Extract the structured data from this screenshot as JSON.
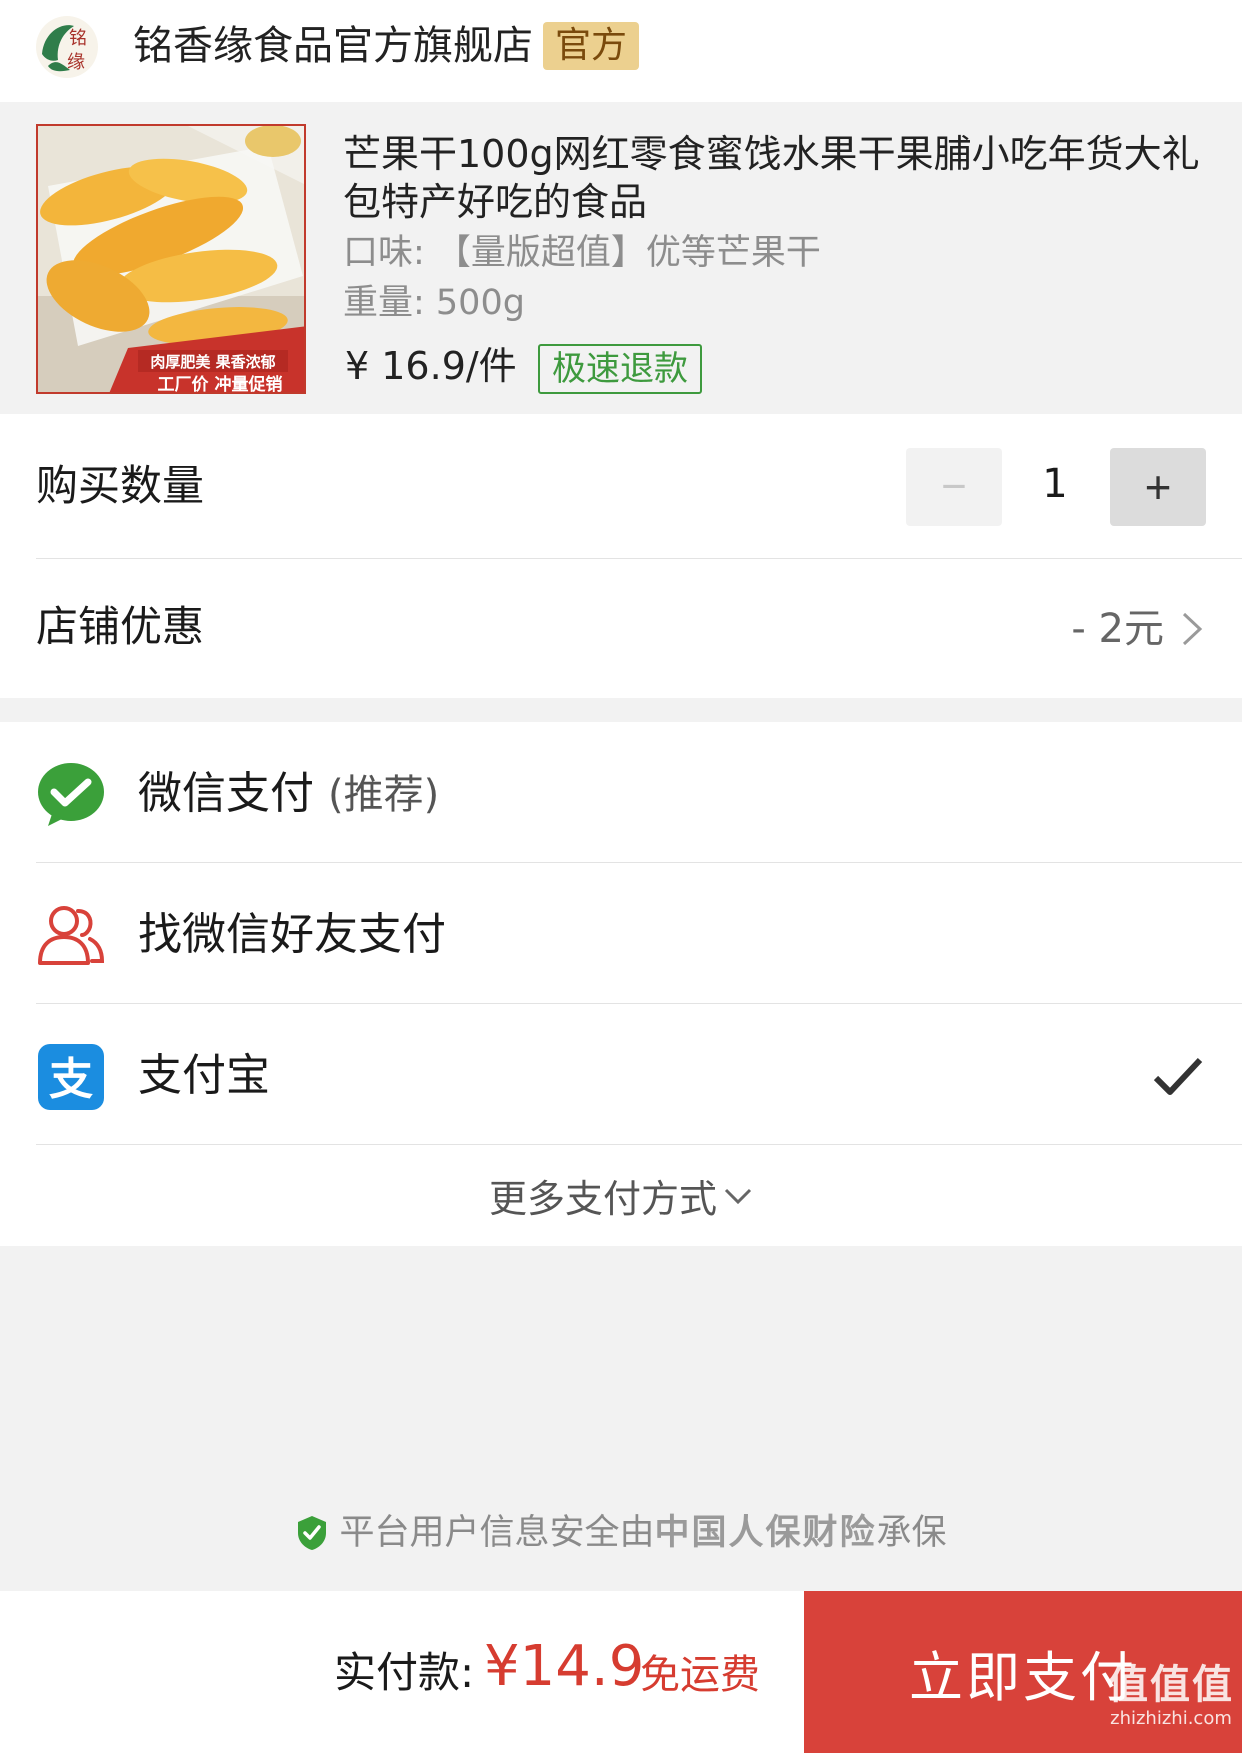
{
  "store": {
    "name": "铭香缘食品官方旗舰店",
    "badge": "官方",
    "logo_text": "铭香缘"
  },
  "product": {
    "title": "芒果干100g网红零食蜜饯水果干果脯小吃年货大礼包特产好吃的食品",
    "flavor": "口味: 【量版超值】优等芒果干",
    "weight": "重量: 500g",
    "price": "¥ 16.9/件",
    "refund_badge": "极速退款",
    "image_caption_1": "肉厚肥美 果香浓郁",
    "image_caption_2": "工厂价 冲量促销"
  },
  "quantity": {
    "label": "购买数量",
    "minus": "−",
    "value": "1",
    "plus": "+"
  },
  "discount": {
    "label": "店铺优惠",
    "value": "- 2元"
  },
  "payment": {
    "methods": [
      {
        "label": "微信支付",
        "note": "(推荐)",
        "icon": "wechat-pay-icon",
        "selected": false
      },
      {
        "label": "找微信好友支付",
        "note": "",
        "icon": "friend-pay-icon",
        "selected": false
      },
      {
        "label": "支付宝",
        "note": "",
        "icon": "alipay-icon",
        "selected": true
      }
    ],
    "more": "更多支付方式"
  },
  "insurance": {
    "prefix": "平台用户信息安全由",
    "insurer": "中国人保财险",
    "suffix": "承保"
  },
  "footer": {
    "total_label": "实付款:",
    "total_amount": "¥14.9",
    "free_shipping": "免运费",
    "pay_button": "立即支付"
  },
  "watermark": {
    "top": "值值值",
    "bottom": "zhizhizhi.com"
  },
  "colors": {
    "accent_red": "#d63c30",
    "pay_button": "#d8423a",
    "refund_green": "#3e9a3e",
    "official_badge": "#ecd08f",
    "wechat_green": "#3ba03a",
    "alipay_blue": "#1b8de0"
  }
}
